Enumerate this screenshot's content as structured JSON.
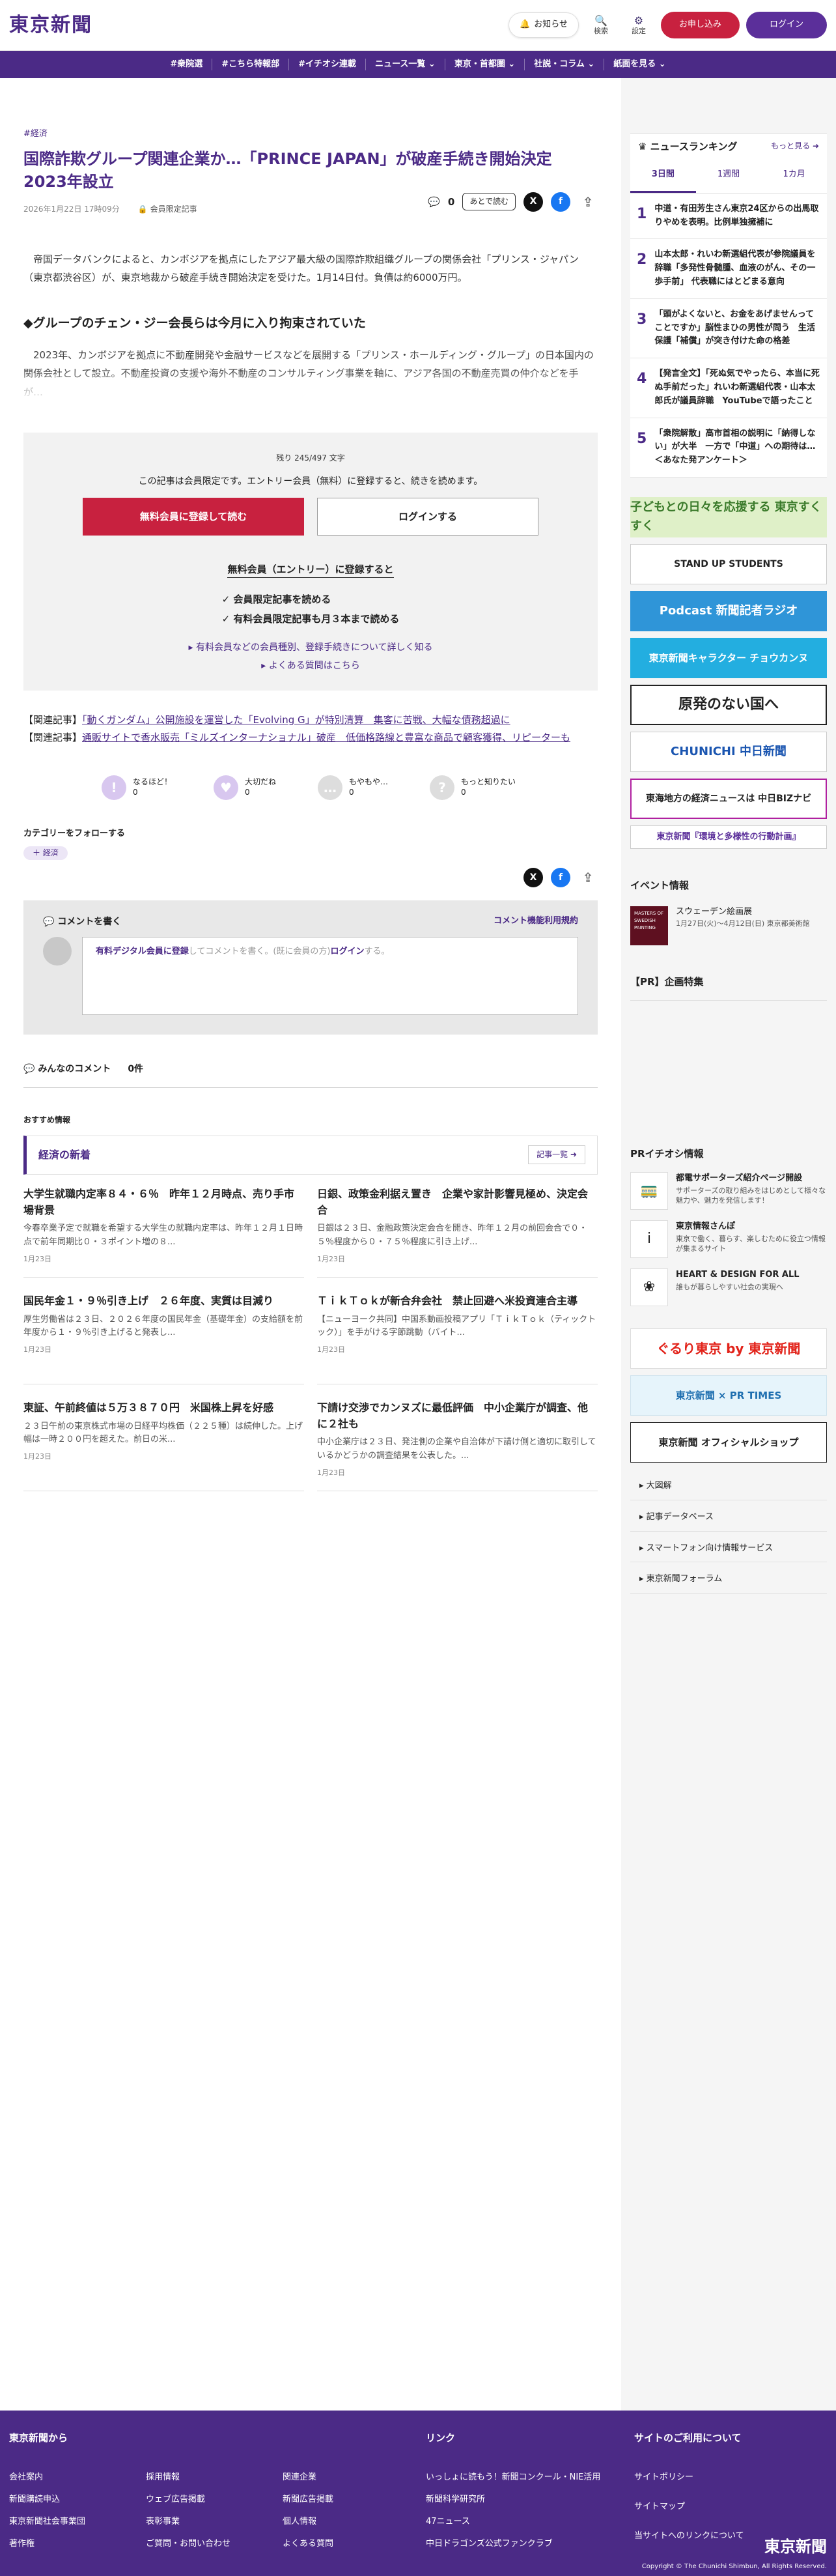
{
  "header": {
    "logo": "東京新聞",
    "notify": "お知らせ",
    "search": "検索",
    "settings": "設定",
    "apply": "お申し込み",
    "login": "ログイン"
  },
  "nav": [
    "#衆院選",
    "#こちら特報部",
    "#イチオシ連載",
    "ニュース一覧 ⌄",
    "東京・首都圏 ⌄",
    "社説・コラム ⌄",
    "紙面を見る ⌄"
  ],
  "article": {
    "tag": "#経済",
    "title": "国際詐欺グループ関連企業か…「PRINCE JAPAN」が破産手続き開始決定 2023年設立",
    "date": "2026年1月22日 17時09分",
    "members": "会員限定記事",
    "comment_count": "0",
    "read_later": "あとで読む",
    "p1": "帝国データバンクによると、カンボジアを拠点にしたアジア最大級の国際詐欺組織グループの関係会社「プリンス・ジャパン（東京都渋谷区）が、東京地裁から破産手続き開始決定を受けた。1月14日付。負債は約6000万円。",
    "h2": "◆グループのチェン・ジー会長らは今月に入り拘束されていた",
    "p2": "2023年、カンボジアを拠点に不動産開発や金融サービスなどを展開する「プリンス・ホールディング・グループ」の日本国内の関係会社として設立。不動産投資の支援や海外不動産のコンサルティング事業を軸に、アジア各国の不動産売買の仲介などを手が…"
  },
  "paywall": {
    "remain": "残り 245/497 文字",
    "msg": "この記事は会員限定です。エントリー会員（無料）に登録すると、続きを読めます。",
    "register": "無料会員に登録して読む",
    "login": "ログインする",
    "head": "無料会員（エントリー）に登録すると",
    "b1": "✓ 会員限定記事を読める",
    "b2": "✓ 有料会員限定記事も月３本まで読める",
    "link1": "▸ 有料会員などの会員種別、登録手続きについて詳しく知る",
    "link2": "▸ よくある質問はこちら"
  },
  "related": {
    "r1_prefix": "【関連記事】",
    "r1": "「動くガンダム」公開施設を運営した「Evolving G」が特別清算　集客に苦戦、大幅な債務超過に",
    "r2_prefix": "【関連記事】",
    "r2": "通販サイトで香水販売「ミルズインターナショナル」破産　低価格路線と豊富な商品で顧客獲得、リピーターも"
  },
  "reactions": [
    {
      "label": "なるほど！",
      "count": "0",
      "glyph": "!"
    },
    {
      "label": "大切だね",
      "count": "0",
      "glyph": "♥"
    },
    {
      "label": "もやもや…",
      "count": "0",
      "glyph": "…"
    },
    {
      "label": "もっと知りたい",
      "count": "0",
      "glyph": "?"
    }
  ],
  "follow": {
    "heading": "カテゴリーをフォローする",
    "chip": "＋ 経済"
  },
  "comment": {
    "heading": "コメントを書く",
    "rules": "コメント機能利用規約",
    "placeholder_a": "有料デジタル会員に登録",
    "placeholder_b": "してコメントを書く。(既に会員の方)",
    "placeholder_c": "ログイン",
    "placeholder_d": "する。"
  },
  "all_comments": {
    "label": "みんなのコメント",
    "count": "0件"
  },
  "recommend": "おすすめ情報",
  "section": {
    "title": "経済の新着",
    "more": "記事一覧 ➜"
  },
  "cards": [
    {
      "title": "大学生就職内定率８４・６％　昨年１２月時点、売り手市場背景",
      "text": "今春卒業予定で就職を希望する大学生の就職内定率は、昨年１２月１日時点で前年同期比０・３ポイント増の８...",
      "date": "1月23日"
    },
    {
      "title": "日銀、政策金利据え置き　企業や家計影響見極め、決定会合",
      "text": "日銀は２３日、金融政策決定会合を開き、昨年１２月の前回会合で０・５％程度から０・７５％程度に引き上げ...",
      "date": "1月23日"
    },
    {
      "title": "国民年金１・９％引き上げ　２６年度、実質は目減り",
      "text": "厚生労働省は２３日、２０２６年度の国民年金（基礎年金）の支給額を前年度から１・９％引き上げると発表し...",
      "date": "1月23日"
    },
    {
      "title": "ＴｉｋＴｏｋが新合弁会社　禁止回避へ米投資連合主導",
      "text": "【ニューヨーク共同】中国系動画投稿アプリ「ＴｉｋＴｏｋ（ティックトック）」を手がける字節跳動（バイト...",
      "date": "1月23日"
    },
    {
      "title": "東証、午前終値は５万３８７０円　米国株上昇を好感",
      "text": "２３日午前の東京株式市場の日経平均株価（２２５種）は続伸した。上げ幅は一時２００円を超えた。前日の米...",
      "date": "1月23日"
    },
    {
      "title": "下請け交渉でカンヌズに最低評価　中小企業庁が調査、他に２社も",
      "text": "中小企業庁は２３日、発注側の企業や自治体が下請け側と適切に取引しているかどうかの調査結果を公表した。...",
      "date": "1月23日"
    }
  ],
  "ranking": {
    "title": "ニュースランキング",
    "more": "もっと見る ➜",
    "tabs": [
      "3日間",
      "1週間",
      "1カ月"
    ],
    "items": [
      "中道・有田芳生さん東京24区からの出馬取りやめを表明。比例単独擁補に",
      "山本太郎・れいわ新選組代表が参院議員を辞職「多発性骨髄腫、血液のがん、その一歩手前」 代表職にはとどまる意向",
      "「頭がよくないと、お金をあげませんってことですか」脳性まひの男性が問う　生活保護「補償」が突き付けた命の格差",
      "【発言全文】「死ぬ気でやったら、本当に死ぬ手前だった」れいわ新選組代表・山本太郎氏が議員辞職　YouTubeで語ったこと",
      "「衆院解散」高市首相の説明に「納得しない」が大半　一方で「中道」への期待は…＜あなた発アンケート＞"
    ]
  },
  "banners": [
    "子どもとの日々を応援する 東京すくすく",
    "STAND UP STUDENTS",
    "Podcast 新聞記者ラジオ",
    "東京新聞キャラクター チョウカンヌ",
    "原発のない国へ",
    "CHUNICHI 中日新聞",
    "東海地方の経済ニュースは 中日BIZナビ",
    "東京新聞『環境と多様性の行動計画』"
  ],
  "events": {
    "heading": "イベント情報",
    "title": "スウェーデン絵画展",
    "sub": "1月27日(火)〜4月12日(日) 東京都美術館",
    "img": "MASTERS OF SWEDISH PAINTING"
  },
  "pr_heading": "【PR】企画特集",
  "pr_ichioshi": {
    "heading": "PRイチオシ情報",
    "items": [
      {
        "t": "都電サポーターズ紹介ページ開設",
        "s": "サポーターズの取り組みをはじめとして様々な魅力や、魅力を発信します！",
        "g": "🚃"
      },
      {
        "t": "東京情報さんぽ",
        "s": "東京で働く、暮らす、楽しむために役立つ情報が集まるサイト",
        "g": "i"
      },
      {
        "t": "HEART & DESIGN FOR ALL",
        "s": "誰もが暮らしやすい社会の実現へ",
        "g": "❀"
      }
    ]
  },
  "side_banners": [
    "ぐるり東京 by 東京新聞",
    "東京新聞 × PR TIMES",
    "東京新聞 オフィシャルショップ"
  ],
  "side_links": [
    "大図解",
    "記事データベース",
    "スマートフォン向け情報サービス",
    "東京新聞フォーラム"
  ],
  "footer": {
    "c1": "東京新聞から",
    "c1_items": [
      "会社案内",
      "採用情報",
      "関連企業",
      "東京新聞読者ページ",
      "新聞購読申込",
      "ウェブ広告掲載",
      "新聞広告掲載",
      "東京新聞社会事業団",
      "表彰事業",
      "個人情報",
      "著作権",
      "ご質問・お問い合わせ",
      "よくある質問"
    ],
    "c2": "リンク",
    "c2_items": [
      "いっしょに読もう！新聞コンクール・NIE活用",
      "新聞科学研究所",
      "47ニュース",
      "中日ドラゴンズ公式ファンクラブ"
    ],
    "c3": "サイトのご利用について",
    "c3_items": [
      "サイトポリシー",
      "サイトマップ",
      "当サイトへのリンクについて"
    ],
    "brand": "東京新聞",
    "copy": "Copyright © The Chunichi Shimbun, All Rights Reserved."
  }
}
